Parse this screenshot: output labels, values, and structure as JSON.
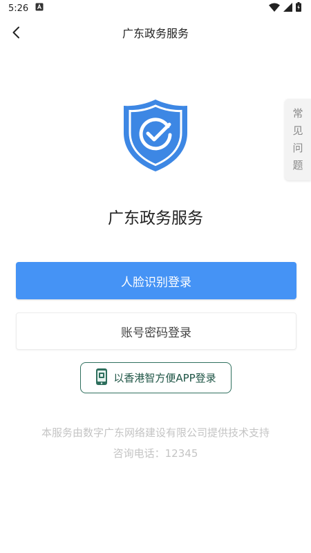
{
  "status_bar": {
    "time": "5:26"
  },
  "nav": {
    "title": "广东政务服务"
  },
  "faq": {
    "chars": [
      "常",
      "见",
      "问",
      "题"
    ]
  },
  "main": {
    "app_title": "广东政务服务",
    "face_login_label": "人脸识别登录",
    "password_login_label": "账号密码登录",
    "hk_login_label": "以香港智方便APP登录"
  },
  "footer": {
    "support_text": "本服务由数字广东网络建设有限公司提供技术支持",
    "hotline_text": "咨询电话：12345"
  },
  "colors": {
    "primary": "#4593f5",
    "shield": "#3d87e4",
    "hk_button": "#2e6f5d",
    "footer_text": "#c4c4c4"
  },
  "icons": [
    "a-notification-icon",
    "wifi-icon",
    "signal-icon",
    "battery-icon",
    "back-arrow-icon",
    "shield-check-icon",
    "phone-app-icon"
  ]
}
